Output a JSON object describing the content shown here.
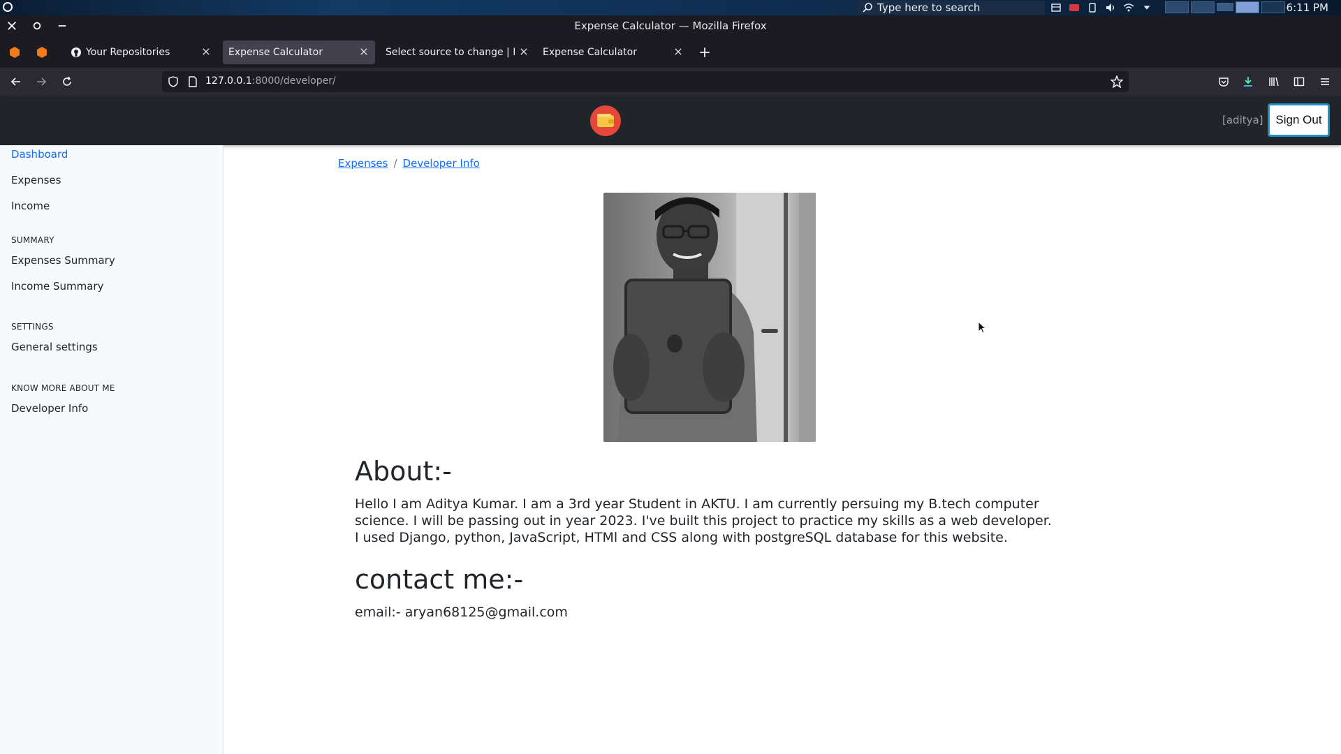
{
  "os": {
    "search_placeholder": "Type here to search",
    "clock": "6:11 PM"
  },
  "browser": {
    "window_title": "Expense Calculator — Mozilla Firefox",
    "tabs": [
      {
        "label": "Your Repositories",
        "active": false
      },
      {
        "label": "Expense Calculator",
        "active": true
      },
      {
        "label": "Select source to change | Djan",
        "active": false
      },
      {
        "label": "Expense Calculator",
        "active": false
      }
    ],
    "url_host": "127.0.0.1",
    "url_rest": ":8000/developer/"
  },
  "header": {
    "username": "[aditya]",
    "signout_label": "Sign Out",
    "brand_color": "#e5483b"
  },
  "sidebar": {
    "items_main": [
      "Dashboard",
      "Expenses",
      "Income"
    ],
    "summary_heading": "SUMMARY",
    "items_summary": [
      "Expenses Summary",
      "Income Summary"
    ],
    "settings_heading": "SETTINGS",
    "items_settings": [
      "General settings"
    ],
    "about_heading": "KNOW MORE ABOUT ME",
    "items_about": [
      "Developer Info"
    ]
  },
  "breadcrumb": {
    "items": [
      "Expenses",
      "Developer Info"
    ],
    "separator": "/"
  },
  "content": {
    "about_heading": "About:-",
    "about_text": "Hello I am Aditya Kumar. I am a 3rd year Student in AKTU. I am currently persuing my B.tech computer science. I will be passing out in year 2023. I've built this project to practice my skills as a web developer. I used Django, python, JavaScript, HTMl and CSS along with postgreSQL database for this website.",
    "contact_heading": "contact me:-",
    "email_line": "email:- aryan68125@gmail.com"
  }
}
